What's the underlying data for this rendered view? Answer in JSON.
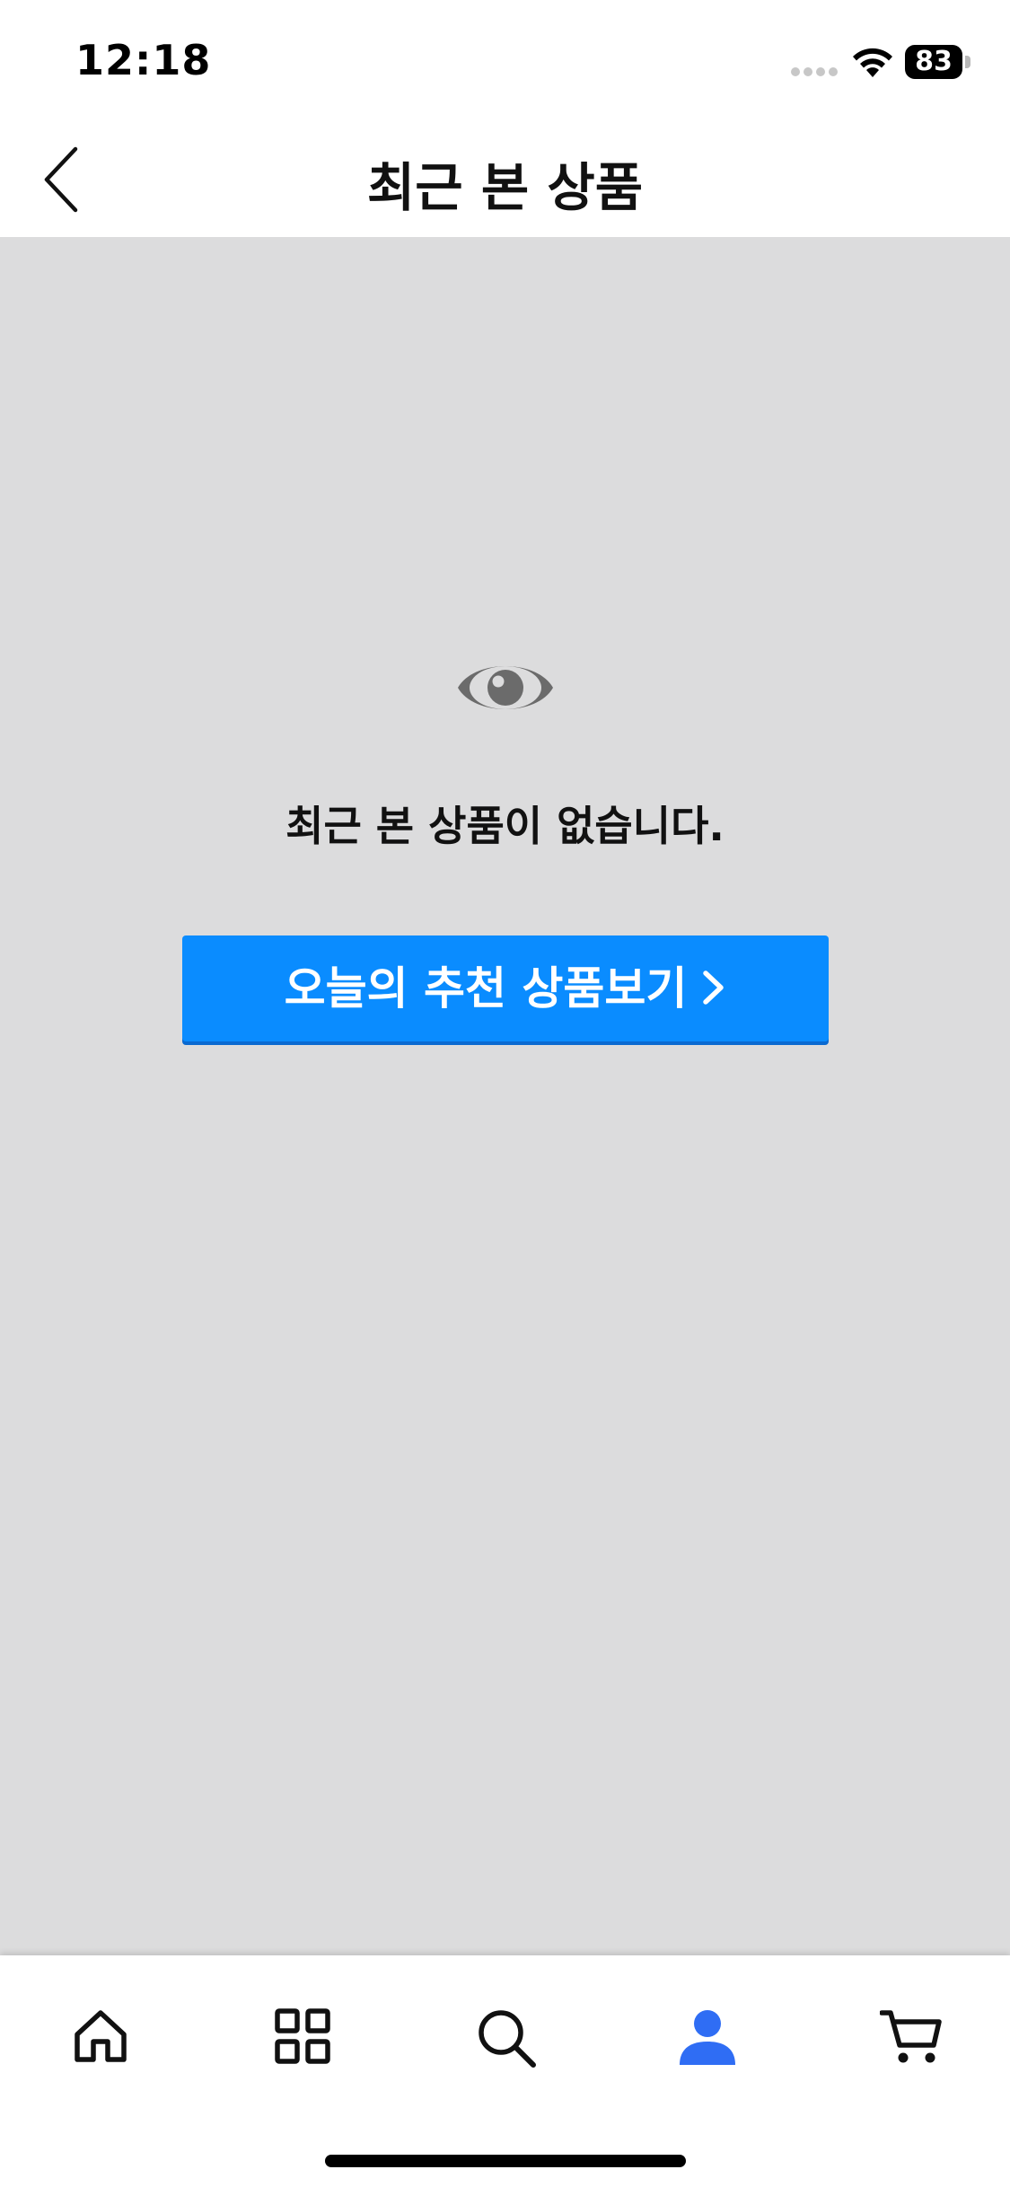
{
  "status_bar": {
    "time": "12:18",
    "battery_level": "83"
  },
  "header": {
    "title": "최근 본 상품",
    "back_icon": "chevron-left-icon"
  },
  "empty_state": {
    "icon": "eye-icon",
    "message": "최근 본 상품이 없습니다.",
    "button_label": "오늘의 추천 상품보기"
  },
  "tab_bar": {
    "items": [
      {
        "icon": "home-icon"
      },
      {
        "icon": "grid-icon"
      },
      {
        "icon": "search-icon"
      },
      {
        "icon": "person-icon",
        "active": true
      },
      {
        "icon": "cart-icon"
      }
    ]
  },
  "colors": {
    "accent": "#0a8cff",
    "active_tab": "#2f6df4",
    "content_bg": "#dcdcdd"
  }
}
